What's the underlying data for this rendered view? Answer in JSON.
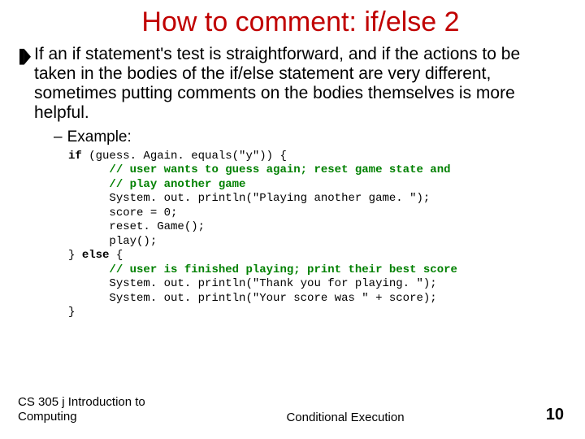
{
  "title": "How to comment: if/else 2",
  "paragraph": "If an if statement's test is straightforward, and if the actions to be taken in the bodies of the if/else statement are very different, sometimes putting comments on the bodies themselves is more helpful.",
  "example_label": "Example:",
  "code": {
    "l1a": "if",
    "l1b": " (guess. Again. equals(\"y\")) {",
    "l2": "// user wants to guess again; reset game state and",
    "l3": "// play another game",
    "l4": "System. out. println(\"Playing another game. \");",
    "l5": "score = 0;",
    "l6": "reset. Game();",
    "l7": "play();",
    "l8a": "} ",
    "l8b": "else",
    "l8c": " {",
    "l9": "// user is finished playing; print their best score",
    "l10": "System. out. println(\"Thank you for playing. \");",
    "l11": "System. out. println(\"Your score was \" + score);",
    "l12": "}"
  },
  "footer": {
    "left": "CS 305 j Introduction to Computing",
    "center": "Conditional Execution",
    "page": "10"
  }
}
